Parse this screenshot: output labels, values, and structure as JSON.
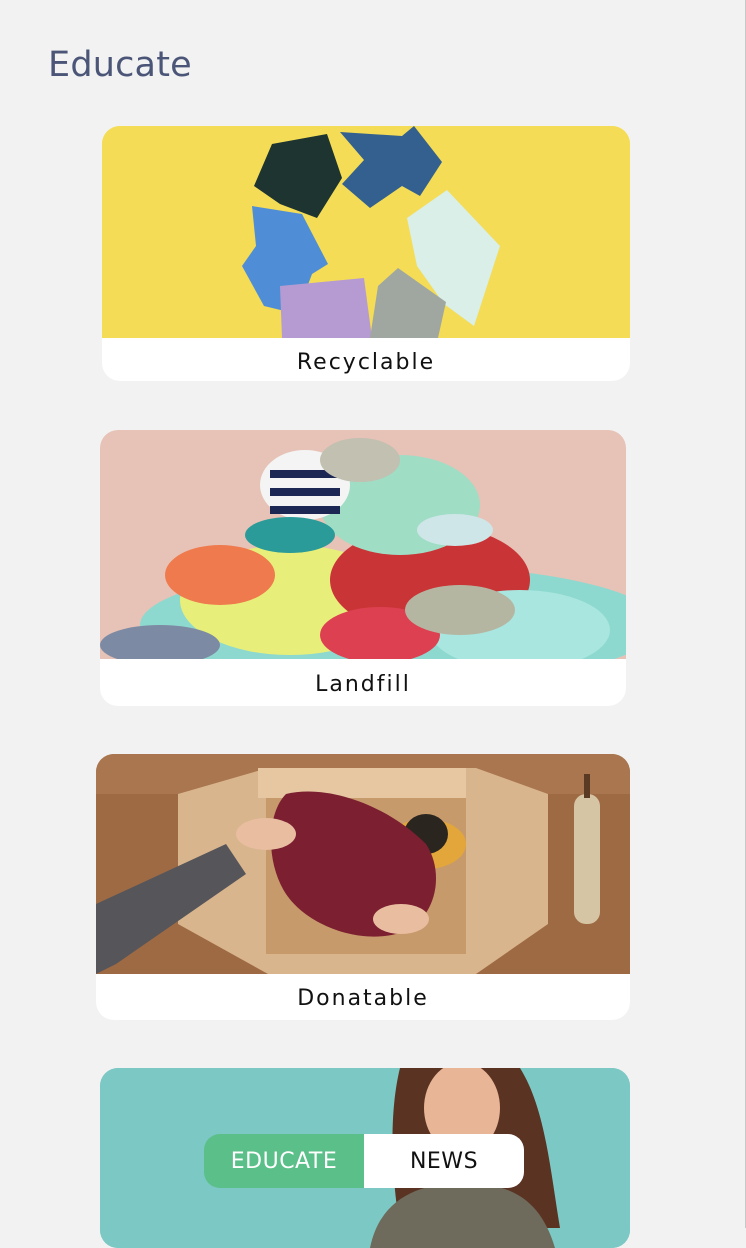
{
  "header": {
    "title": "Educate"
  },
  "cards": [
    {
      "label": "Recyclable",
      "image": "recycle-arrows-fabric-image"
    },
    {
      "label": "Landfill",
      "image": "clothes-pile-image"
    },
    {
      "label": "Donatable",
      "image": "donation-box-image"
    }
  ],
  "bottom_nav": {
    "educate_label": "EDUCATE",
    "news_label": "NEWS",
    "active": "EDUCATE"
  },
  "colors": {
    "title": "#4b5577",
    "accent": "#5bbf8a",
    "teal": "#7cc8c4",
    "background": "#f2f2f2"
  }
}
